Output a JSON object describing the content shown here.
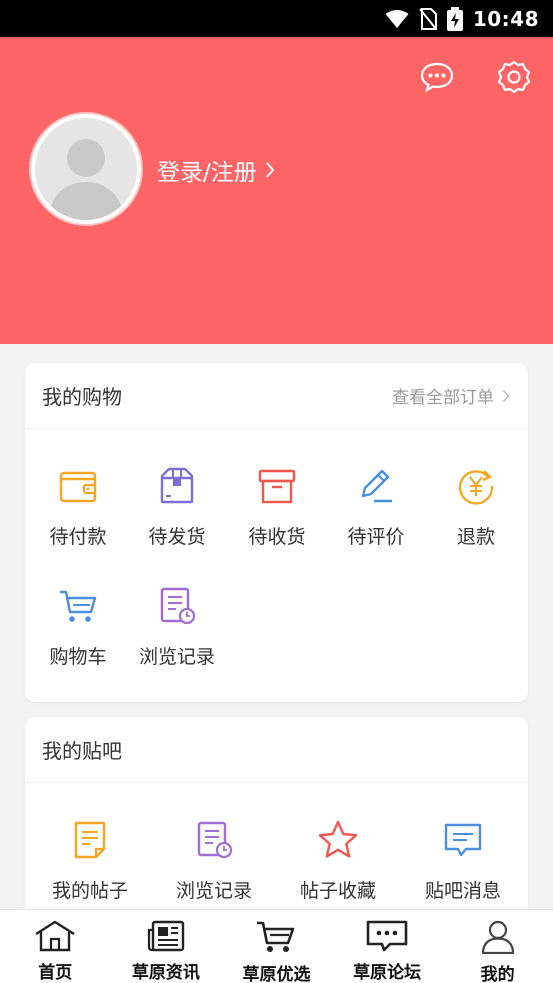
{
  "status_bar": {
    "time": "10:48"
  },
  "header": {
    "login_label": "登录/注册",
    "icons": {
      "messages": "chat-bubble-icon",
      "settings": "gear-icon"
    },
    "colors": {
      "background": "#fd6466"
    }
  },
  "shopping": {
    "title": "我的购物",
    "view_all_label": "查看全部订单",
    "items": [
      {
        "label": "待付款",
        "icon": "wallet-icon"
      },
      {
        "label": "待发货",
        "icon": "package-box-icon"
      },
      {
        "label": "待收货",
        "icon": "delivery-box-icon"
      },
      {
        "label": "待评价",
        "icon": "pen-review-icon"
      },
      {
        "label": "退款",
        "icon": "yen-refund-icon"
      },
      {
        "label": "购物车",
        "icon": "shopping-cart-icon"
      },
      {
        "label": "浏览记录",
        "icon": "history-document-icon"
      }
    ]
  },
  "tieba": {
    "title": "我的贴吧",
    "items": [
      {
        "label": "我的帖子",
        "icon": "post-document-icon"
      },
      {
        "label": "浏览记录",
        "icon": "history-document-icon"
      },
      {
        "label": "帖子收藏",
        "icon": "star-icon"
      },
      {
        "label": "贴吧消息",
        "icon": "message-icon"
      }
    ]
  },
  "tabbar": {
    "items": [
      {
        "label": "首页",
        "icon": "home-icon"
      },
      {
        "label": "草原资讯",
        "icon": "newspaper-icon"
      },
      {
        "label": "草原优选",
        "icon": "cart-icon"
      },
      {
        "label": "草原论坛",
        "icon": "forum-chat-icon"
      },
      {
        "label": "我的",
        "icon": "user-icon"
      }
    ]
  },
  "colors": {
    "orange": "#f5a623",
    "purple": "#a06cd5",
    "red": "#f0574e",
    "blue": "#4a90e2"
  }
}
